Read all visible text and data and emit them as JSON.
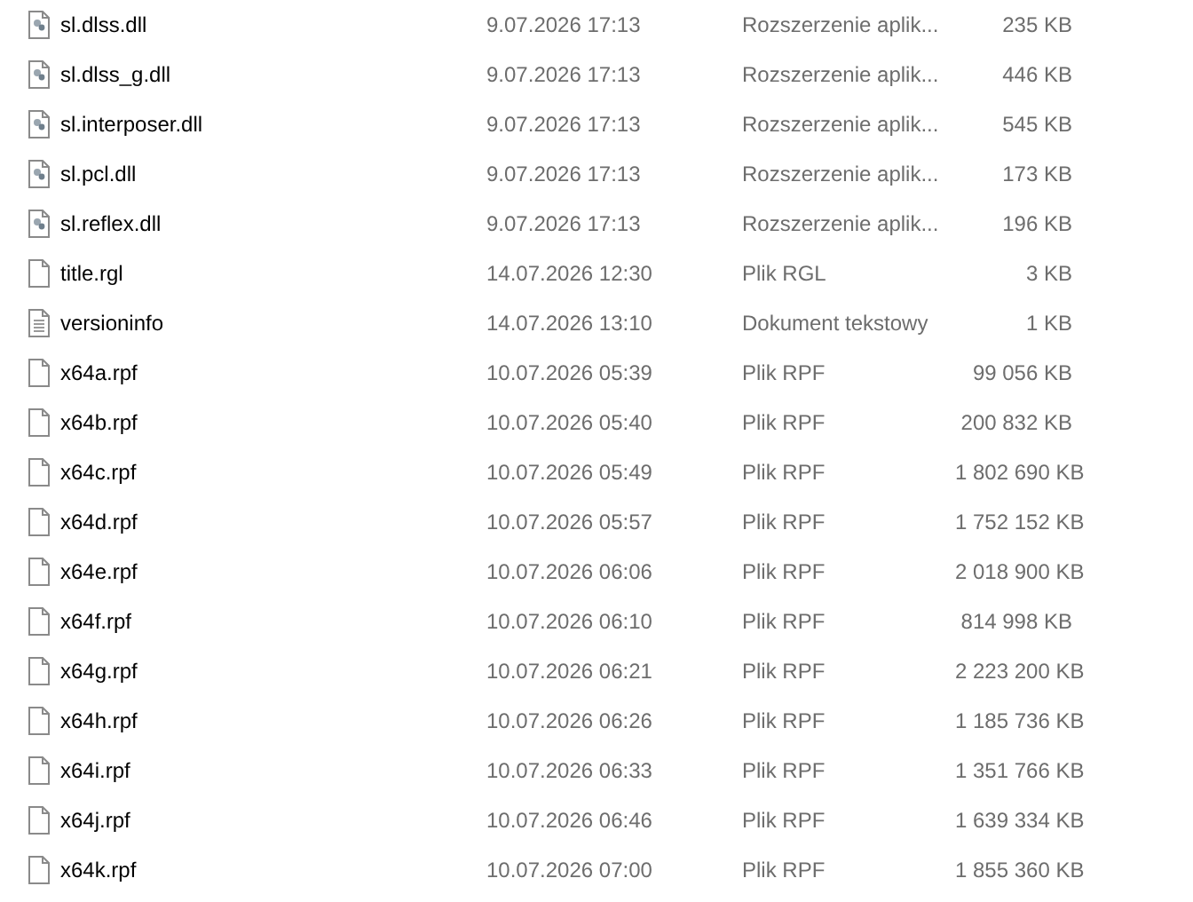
{
  "files": [
    {
      "kind": "dll",
      "name": "sl.dlss.dll",
      "modified": "9.07.2026 17:13",
      "type": "Rozszerzenie aplik...",
      "size": "235 KB"
    },
    {
      "kind": "dll",
      "name": "sl.dlss_g.dll",
      "modified": "9.07.2026 17:13",
      "type": "Rozszerzenie aplik...",
      "size": "446 KB"
    },
    {
      "kind": "dll",
      "name": "sl.interposer.dll",
      "modified": "9.07.2026 17:13",
      "type": "Rozszerzenie aplik...",
      "size": "545 KB"
    },
    {
      "kind": "dll",
      "name": "sl.pcl.dll",
      "modified": "9.07.2026 17:13",
      "type": "Rozszerzenie aplik...",
      "size": "173 KB"
    },
    {
      "kind": "dll",
      "name": "sl.reflex.dll",
      "modified": "9.07.2026 17:13",
      "type": "Rozszerzenie aplik...",
      "size": "196 KB"
    },
    {
      "kind": "blank",
      "name": "title.rgl",
      "modified": "14.07.2026 12:30",
      "type": "Plik RGL",
      "size": "3 KB"
    },
    {
      "kind": "text",
      "name": "versioninfo",
      "modified": "14.07.2026 13:10",
      "type": "Dokument tekstowy",
      "size": "1 KB"
    },
    {
      "kind": "blank",
      "name": "x64a.rpf",
      "modified": "10.07.2026 05:39",
      "type": "Plik RPF",
      "size": "99 056 KB"
    },
    {
      "kind": "blank",
      "name": "x64b.rpf",
      "modified": "10.07.2026 05:40",
      "type": "Plik RPF",
      "size": "200 832 KB"
    },
    {
      "kind": "blank",
      "name": "x64c.rpf",
      "modified": "10.07.2026 05:49",
      "type": "Plik RPF",
      "size": "1 802 690 KB"
    },
    {
      "kind": "blank",
      "name": "x64d.rpf",
      "modified": "10.07.2026 05:57",
      "type": "Plik RPF",
      "size": "1 752 152 KB"
    },
    {
      "kind": "blank",
      "name": "x64e.rpf",
      "modified": "10.07.2026 06:06",
      "type": "Plik RPF",
      "size": "2 018 900 KB"
    },
    {
      "kind": "blank",
      "name": "x64f.rpf",
      "modified": "10.07.2026 06:10",
      "type": "Plik RPF",
      "size": "814 998 KB"
    },
    {
      "kind": "blank",
      "name": "x64g.rpf",
      "modified": "10.07.2026 06:21",
      "type": "Plik RPF",
      "size": "2 223 200 KB"
    },
    {
      "kind": "blank",
      "name": "x64h.rpf",
      "modified": "10.07.2026 06:26",
      "type": "Plik RPF",
      "size": "1 185 736 KB"
    },
    {
      "kind": "blank",
      "name": "x64i.rpf",
      "modified": "10.07.2026 06:33",
      "type": "Plik RPF",
      "size": "1 351 766 KB"
    },
    {
      "kind": "blank",
      "name": "x64j.rpf",
      "modified": "10.07.2026 06:46",
      "type": "Plik RPF",
      "size": "1 639 334 KB"
    },
    {
      "kind": "blank",
      "name": "x64k.rpf",
      "modified": "10.07.2026 07:00",
      "type": "Plik RPF",
      "size": "1 855 360 KB"
    }
  ]
}
